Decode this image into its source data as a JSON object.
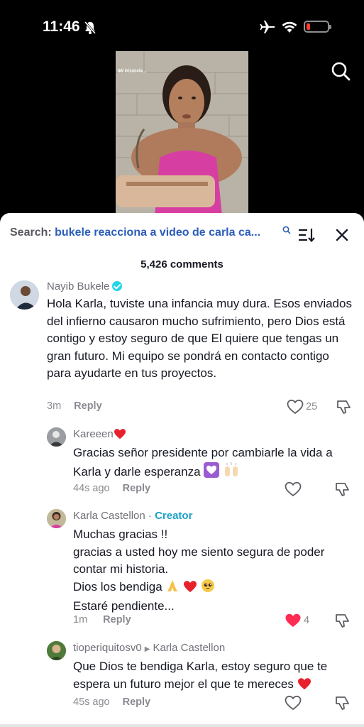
{
  "status": {
    "time": "11:46"
  },
  "video": {
    "caption": "Mi historia..."
  },
  "sheet": {
    "search_label": "Search:",
    "search_query": "bukele reacciona a video de carla ca...",
    "comment_count": "5,426 comments"
  },
  "comments": [
    {
      "author": "Nayib Bukele",
      "text": "Hola Karla, tuviste una infancia muy dura. Esos enviados del infierno causaron mucho sufrimiento, pero Dios está contigo y estoy seguro de que El quiere que tengas un gran futuro. Mi equipo se pondrá en contacto contigo para ayudarte en tus proyectos.",
      "time": "3m",
      "reply": "Reply",
      "likes": "25"
    },
    {
      "author": "Kareeen",
      "text": "Gracias señor presidente por cambiarle la vida a Karla y darle esperanza",
      "time": "44s ago",
      "reply": "Reply"
    },
    {
      "author": "Karla Castellon",
      "badge": "Creator",
      "lines": [
        "Muchas gracias !!",
        "gracias a usted hoy me siento segura de poder",
        "contar mi historia.",
        "Dios los bendiga",
        "Estaré pendiente..."
      ],
      "time": "1m",
      "reply": "Reply",
      "likes": "4"
    },
    {
      "author": "tioperiquitosv0",
      "reply_to": "Karla Castellon",
      "text": "Que Dios te bendiga Karla, estoy seguro que te espera un futuro mejor el que te mereces",
      "time": "45s ago",
      "reply": "Reply"
    }
  ],
  "colors": {
    "accent_link": "#2b5db9",
    "creator": "#1fa0c9",
    "liked": "#fe2c55"
  }
}
